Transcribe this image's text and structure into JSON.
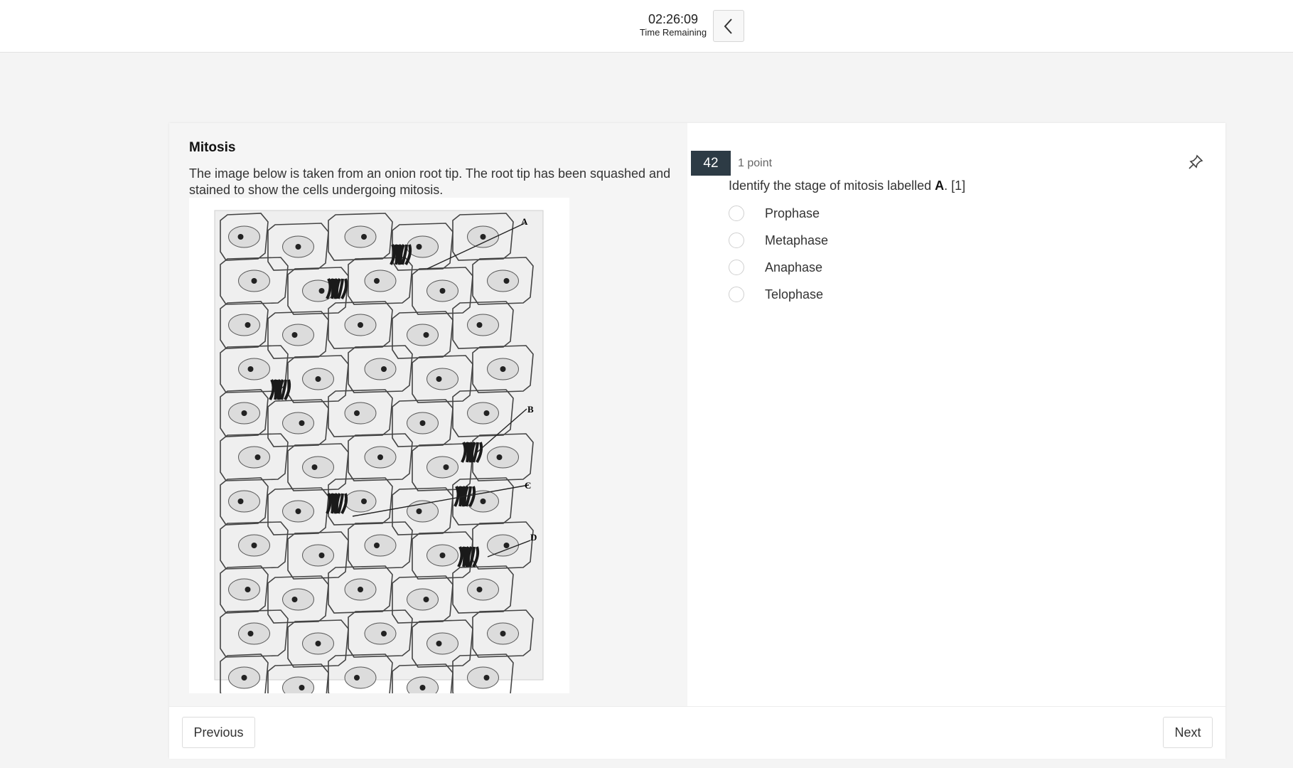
{
  "timer": {
    "value": "02:26:09",
    "label": "Time Remaining"
  },
  "passage": {
    "title": "Mitosis",
    "text": "The image below is taken from an onion root tip. The root tip has been squashed and stained to show the cells undergoing mitosis.",
    "figure_labels": [
      "A",
      "B",
      "C",
      "D"
    ]
  },
  "question": {
    "number": "42",
    "points": "1 point",
    "text_before": "Identify the stage of mitosis labelled ",
    "text_bold": "A",
    "text_after": ". [1]",
    "options": [
      "Prophase",
      "Metaphase",
      "Anaphase",
      "Telophase"
    ]
  },
  "nav": {
    "previous": "Previous",
    "next": "Next"
  },
  "colors": {
    "question_badge": "#2d3b45",
    "page_background": "#f4f4f4"
  },
  "icons": {
    "collapse": "chevron-left-icon",
    "pin": "pin-icon"
  }
}
